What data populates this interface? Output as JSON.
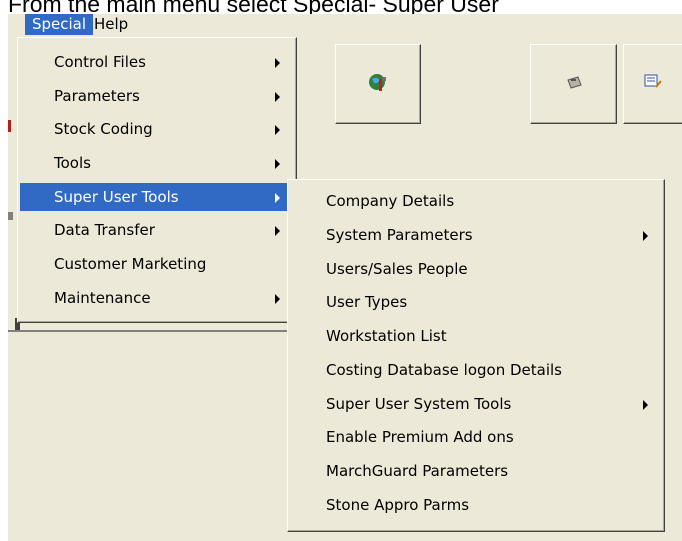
{
  "caption": "From the main menu select Special- Super User",
  "menubar": {
    "items": [
      {
        "label": "Special",
        "active": true
      },
      {
        "label": "Help",
        "active": false
      }
    ]
  },
  "special_menu": {
    "items": [
      {
        "label": "Control Files",
        "submenu": true
      },
      {
        "label": "Parameters",
        "submenu": true
      },
      {
        "label": "Stock Coding",
        "submenu": true
      },
      {
        "label": "Tools",
        "submenu": true
      },
      {
        "label": "Super User Tools",
        "submenu": true,
        "highlighted": true
      },
      {
        "label": "Data Transfer",
        "submenu": true
      },
      {
        "label": "Customer Marketing",
        "submenu": false
      },
      {
        "label": "Maintenance",
        "submenu": true
      }
    ]
  },
  "super_user_menu": {
    "items": [
      {
        "label": "Company Details",
        "submenu": false
      },
      {
        "label": "System Parameters",
        "submenu": true
      },
      {
        "label": "Users/Sales People",
        "submenu": false
      },
      {
        "label": "User Types",
        "submenu": false
      },
      {
        "label": "Workstation List",
        "submenu": false
      },
      {
        "label": "Costing Database logon Details",
        "submenu": false
      },
      {
        "label": "Super User System Tools",
        "submenu": true
      },
      {
        "label": "Enable Premium Add ons",
        "submenu": false
      },
      {
        "label": "MarchGuard Parameters",
        "submenu": false
      },
      {
        "label": "Stone Appro Parms",
        "submenu": false
      }
    ]
  },
  "toolbar": {
    "icons": [
      "globe-tools-icon",
      "toaster-icon",
      "notepad-icon"
    ]
  },
  "colors": {
    "menu_bg": "#ece9d8",
    "highlight": "#316ac5",
    "highlight_text": "#ffffff"
  }
}
